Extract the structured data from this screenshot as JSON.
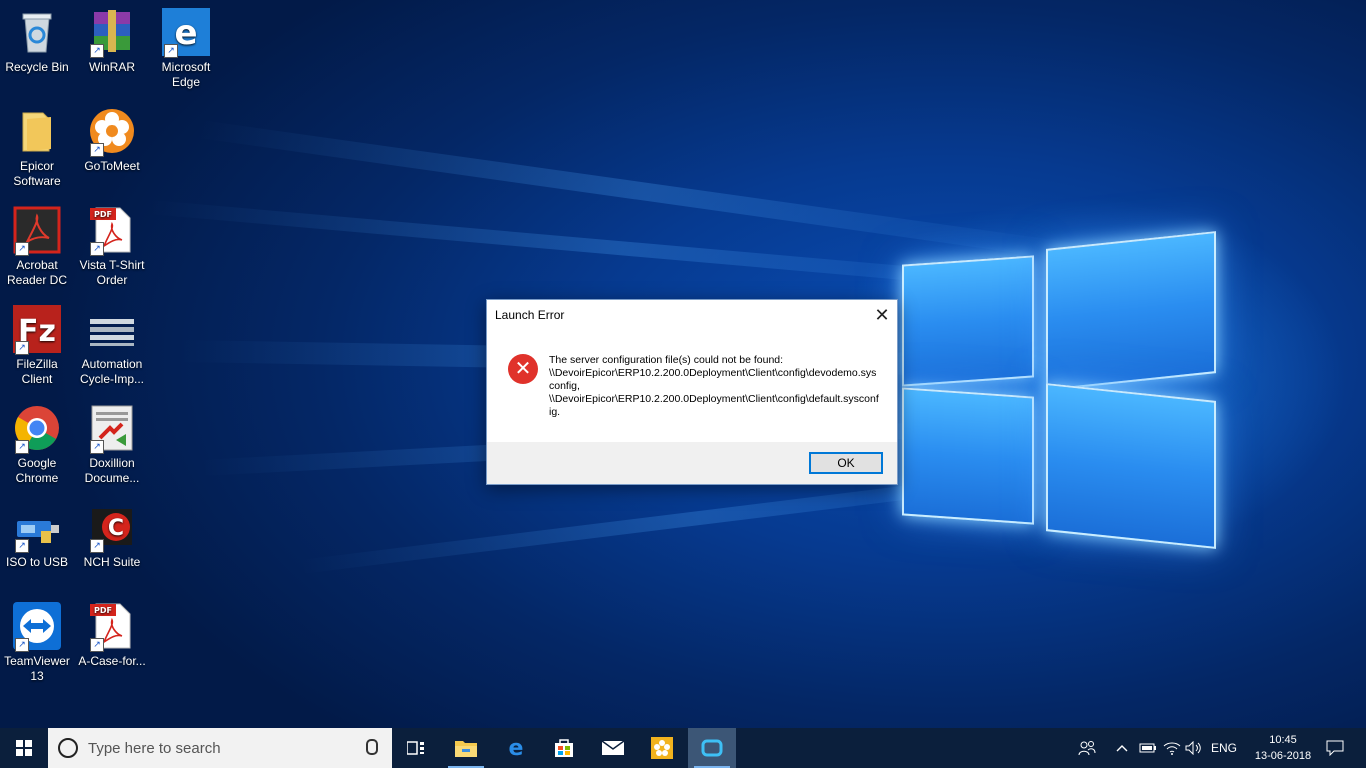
{
  "desktop_icons": [
    {
      "label": "Recycle Bin",
      "icon": "recycle-bin-icon"
    },
    {
      "label": "WinRAR",
      "icon": "winrar-icon"
    },
    {
      "label": "Microsoft Edge",
      "icon": "edge-icon"
    },
    {
      "label": "Epicor Software",
      "icon": "folder-icon"
    },
    {
      "label": "GoToMeet",
      "icon": "gotomeeting-icon"
    },
    {
      "label": "Acrobat Reader DC",
      "icon": "acrobat-icon"
    },
    {
      "label": "Vista T-Shirt Order",
      "icon": "pdf-icon"
    },
    {
      "label": "FileZilla Client",
      "icon": "filezilla-icon"
    },
    {
      "label": "Automation Cycle-Imp...",
      "icon": "document-icon"
    },
    {
      "label": "Google Chrome",
      "icon": "chrome-icon"
    },
    {
      "label": "Doxillion Docume...",
      "icon": "doxillion-icon"
    },
    {
      "label": "ISO to USB",
      "icon": "iso-to-usb-icon"
    },
    {
      "label": "NCH Suite",
      "icon": "nch-suite-icon"
    },
    {
      "label": "TeamViewer 13",
      "icon": "teamviewer-icon"
    },
    {
      "label": "A-Case-for...",
      "icon": "pdf-icon"
    }
  ],
  "dialog": {
    "title": "Launch Error",
    "close_glyph": "✕",
    "error_glyph": "✕",
    "message_line1": "The server configuration file(s) could not be found:",
    "message_path1": "\\\\DevoirEpicor\\ERP10.2.200.0Deployment\\Client\\config\\devodemo.sysconfig,",
    "message_path2": "\\\\DevoirEpicor\\ERP10.2.200.0Deployment\\Client\\config\\default.sysconfig.",
    "ok_label": "OK"
  },
  "taskbar": {
    "search_placeholder": "Type here to search",
    "language": "ENG",
    "time": "10:45",
    "date": "13-06-2018"
  },
  "colors": {
    "error_red": "#e0322b",
    "taskbar_bg": "#0b1f3c",
    "accent": "#0078d7"
  }
}
